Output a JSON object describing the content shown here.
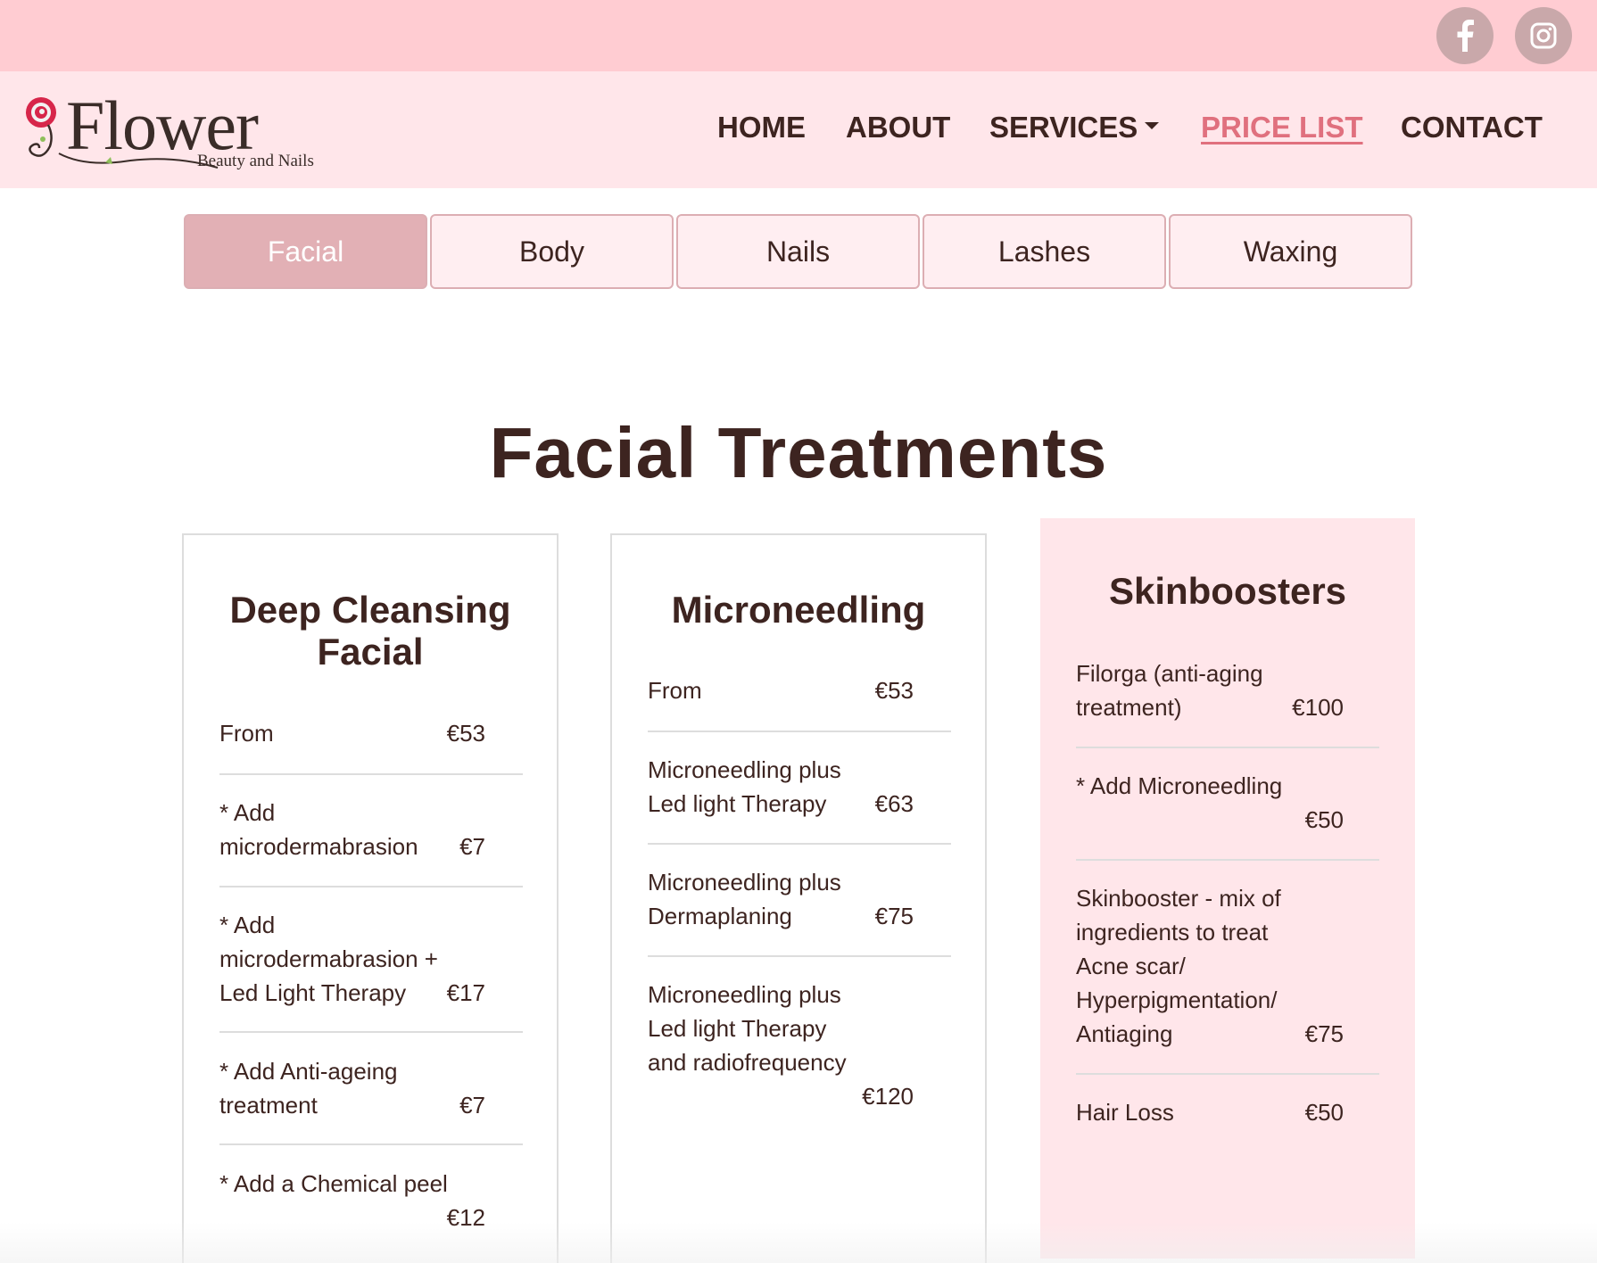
{
  "social": [
    {
      "name": "facebook",
      "icon": "facebook-icon"
    },
    {
      "name": "instagram",
      "icon": "instagram-icon"
    }
  ],
  "logo": {
    "word": "Flower",
    "subtitle": "Beauty and Nails"
  },
  "nav": {
    "home": "HOME",
    "about": "ABOUT",
    "services": "SERVICES",
    "price_list": "PRICE LIST",
    "contact": "CONTACT",
    "active": "price_list"
  },
  "tabs": [
    {
      "label": "Facial",
      "active": true
    },
    {
      "label": "Body",
      "active": false
    },
    {
      "label": "Nails",
      "active": false
    },
    {
      "label": "Lashes",
      "active": false
    },
    {
      "label": "Waxing",
      "active": false
    }
  ],
  "heading": "Facial Treatments",
  "cards": [
    {
      "title_lines": [
        "Deep Cleansing",
        "Facial"
      ],
      "items": [
        {
          "lines": [
            "From"
          ],
          "price": "€53"
        },
        {
          "lines": [
            "* Add",
            "microdermabrasion"
          ],
          "price": "€7"
        },
        {
          "lines": [
            "* Add",
            "microdermabrasion +",
            "Led Light Therapy"
          ],
          "price": "€17"
        },
        {
          "lines": [
            "* Add Anti-ageing",
            "treatment"
          ],
          "price": "€7"
        },
        {
          "lines": [
            "* Add a Chemical peel"
          ],
          "price": "€12"
        }
      ]
    },
    {
      "title_lines": [
        "Microneedling"
      ],
      "items": [
        {
          "lines": [
            "From"
          ],
          "price": "€53"
        },
        {
          "lines": [
            "Microneedling plus",
            "Led light Therapy"
          ],
          "price": "€63"
        },
        {
          "lines": [
            "Microneedling plus",
            "Dermaplaning"
          ],
          "price": "€75"
        },
        {
          "lines": [
            "Microneedling plus",
            "Led light Therapy",
            "and radiofrequency"
          ],
          "price": "€120"
        }
      ]
    },
    {
      "title_lines": [
        "Skinboosters"
      ],
      "items": [
        {
          "lines": [
            "Filorga (anti-aging",
            "treatment)"
          ],
          "price": "€100"
        },
        {
          "lines": [
            "* Add Microneedling"
          ],
          "price": "€50"
        },
        {
          "lines": [
            "Skinbooster - mix of",
            "ingredients to treat",
            "Acne scar/",
            "Hyperpigmentation/",
            "Antiaging"
          ],
          "price": "€75"
        },
        {
          "lines": [
            "Hair Loss"
          ],
          "price": "€50"
        }
      ]
    }
  ],
  "colors": {
    "topbar": "#ffccd2",
    "header": "#ffe6ea",
    "accent": "#e0707e",
    "active_tab": "#e2b0b5",
    "text": "#3d2420"
  }
}
